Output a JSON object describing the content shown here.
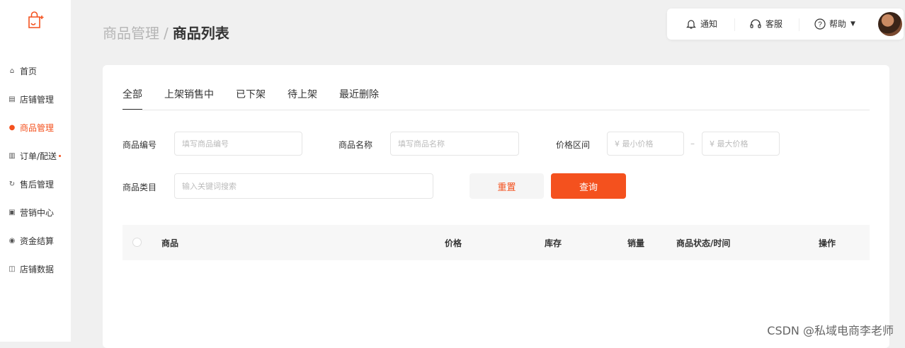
{
  "sidebar": {
    "logo_icon": "shopping-bag-icon",
    "items": [
      {
        "label": "首页",
        "icon": "home-icon"
      },
      {
        "label": "店铺管理",
        "icon": "store-icon"
      },
      {
        "label": "商品管理",
        "icon": "product-icon",
        "active": true
      },
      {
        "label": "订单/配送",
        "icon": "order-icon",
        "badge_dot": true
      },
      {
        "label": "售后管理",
        "icon": "after-sales-icon"
      },
      {
        "label": "营销中心",
        "icon": "marketing-icon"
      },
      {
        "label": "资金结算",
        "icon": "funds-icon"
      },
      {
        "label": "店铺数据",
        "icon": "data-icon"
      }
    ]
  },
  "breadcrumb": {
    "parent": "商品管理",
    "separator": "/",
    "current": "商品列表"
  },
  "topbar": {
    "notify": "通知",
    "service": "客服",
    "help": "帮助"
  },
  "tabs": [
    "全部",
    "上架销售中",
    "已下架",
    "待上架",
    "最近删除"
  ],
  "filters": {
    "product_no_label": "商品编号",
    "product_no_placeholder": "填写商品编号",
    "product_name_label": "商品名称",
    "product_name_placeholder": "填写商品名称",
    "price_label": "价格区间",
    "price_min_placeholder": "¥  最小价格",
    "price_dash": "–",
    "price_max_placeholder": "¥  最大价格",
    "category_label": "商品类目",
    "category_placeholder": "输入关键词搜索",
    "reset": "重置",
    "query": "查询"
  },
  "table": {
    "columns": [
      "商品",
      "价格",
      "库存",
      "销量",
      "商品状态/时间",
      "操作"
    ]
  },
  "watermark": "CSDN @私域电商李老师",
  "colors": {
    "accent": "#f4511e",
    "background": "#f0f0f0"
  }
}
